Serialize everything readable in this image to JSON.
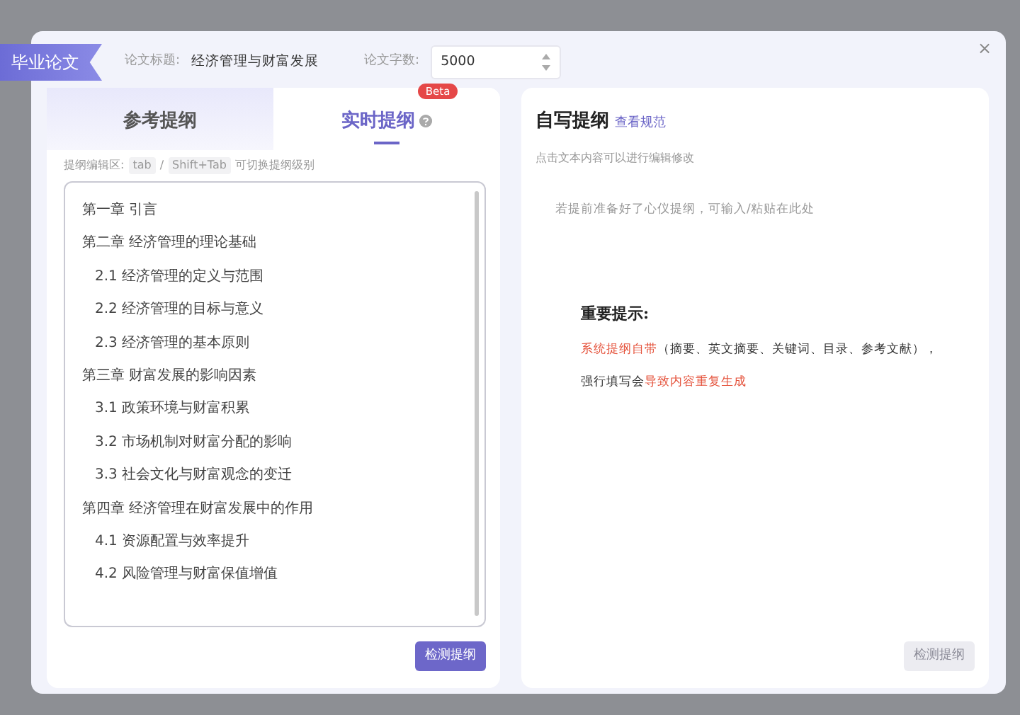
{
  "header": {
    "ribbon": "毕业论文",
    "title_label": "论文标题:",
    "title_value": "经济管理与财富发展",
    "count_label": "论文字数:",
    "count_value": "5000"
  },
  "left_panel": {
    "tabs": [
      {
        "label": "参考提纲",
        "selected": false,
        "help": false
      },
      {
        "label": "实时提纲",
        "selected": true,
        "badge": "Beta",
        "help": true
      }
    ],
    "hint": [
      {
        "text": "提纲编辑区:",
        "key": false
      },
      {
        "text": "tab",
        "key": true
      },
      {
        "text": "/",
        "key": false
      },
      {
        "text": "Shift+Tab",
        "key": true
      },
      {
        "text": "可切换提纲级别",
        "key": false
      }
    ],
    "outline": [
      {
        "text": "第一章 引言"
      },
      {
        "text": "第二章 经济管理的理论基础",
        "children": [
          {
            "text": "2.1 经济管理的定义与范围"
          },
          {
            "text": "2.2 经济管理的目标与意义"
          },
          {
            "text": "2.3 经济管理的基本原则"
          }
        ]
      },
      {
        "text": "第三章 财富发展的影响因素",
        "children": [
          {
            "text": "3.1 政策环境与财富积累"
          },
          {
            "text": "3.2 市场机制对财富分配的影响"
          },
          {
            "text": "3.3 社会文化与财富观念的变迁"
          }
        ]
      },
      {
        "text": "第四章 经济管理在财富发展中的作用",
        "children": [
          {
            "text": "4.1 资源配置与效率提升"
          },
          {
            "text": "4.2 风险管理与财富保值增值"
          }
        ]
      }
    ],
    "button": {
      "label": "检测提纲",
      "disabled": false
    }
  },
  "right_panel": {
    "title": "自写提纲",
    "link": "查看规范",
    "subtitle": "点击文本内容可以进行编辑修改",
    "placeholder": "若提前准备好了心仪提纲，可输入/粘贴在此处",
    "notice_title": "重要提示:",
    "notice_lines": [
      [
        {
          "text": "系统提纲自带",
          "highlight": true
        },
        {
          "text": "（摘要、英文摘要、关键词、目录、参考文献），",
          "highlight": false
        }
      ],
      [
        {
          "text": "强行填写会",
          "highlight": false
        },
        {
          "text": "导致内容重复生成",
          "highlight": true
        }
      ]
    ],
    "button": {
      "label": "检测提纲",
      "disabled": true
    }
  },
  "close": "×"
}
